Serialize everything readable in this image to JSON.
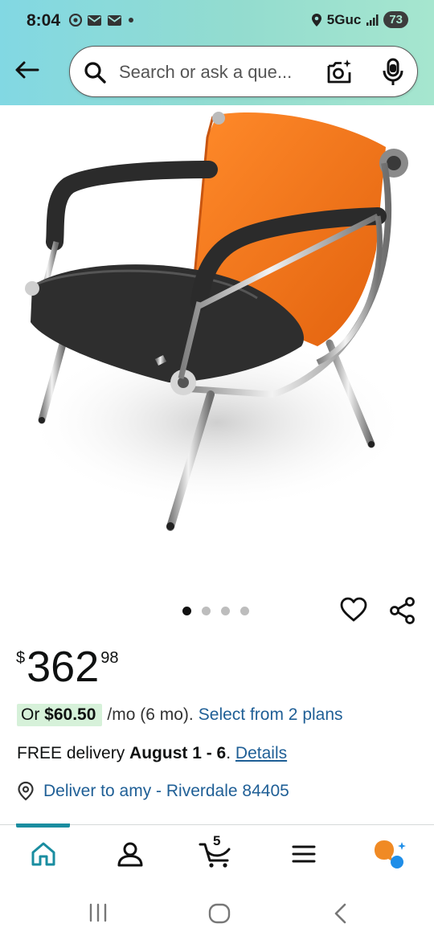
{
  "status_bar": {
    "time": "8:04",
    "network": "5Guc",
    "battery": "73"
  },
  "search": {
    "placeholder": "Search or ask a que..."
  },
  "product": {
    "image_icon": "orange-black-reception-chair",
    "carousel": {
      "total": 4,
      "active": 0
    },
    "price": {
      "symbol": "$",
      "whole": "362",
      "fraction": "98"
    },
    "monthly": {
      "prefix": "Or",
      "amount": "$60.50",
      "term": "/mo (6 mo).",
      "plans_link": "Select from 2 plans"
    },
    "delivery": {
      "prefix": "FREE delivery",
      "date": "August 1 - 6",
      "suffix": ".",
      "details_link": "Details"
    },
    "deliver_to": "Deliver to amy - Riverdale 84405"
  },
  "bottom_nav": {
    "items": [
      "home-icon",
      "account-icon",
      "cart-icon",
      "menu-icon",
      "rufus-icon"
    ],
    "cart_count": "5",
    "active": "home"
  },
  "colors": {
    "header_start": "#82d8e3",
    "header_end": "#a6e6cf",
    "link": "#1f5f96",
    "badge_green": "#d6f1d9",
    "active_nav": "#1a8da0",
    "chair_orange": "#f07a1c",
    "rufus_orange": "#f08a24",
    "rufus_blue": "#1f8ee8"
  }
}
